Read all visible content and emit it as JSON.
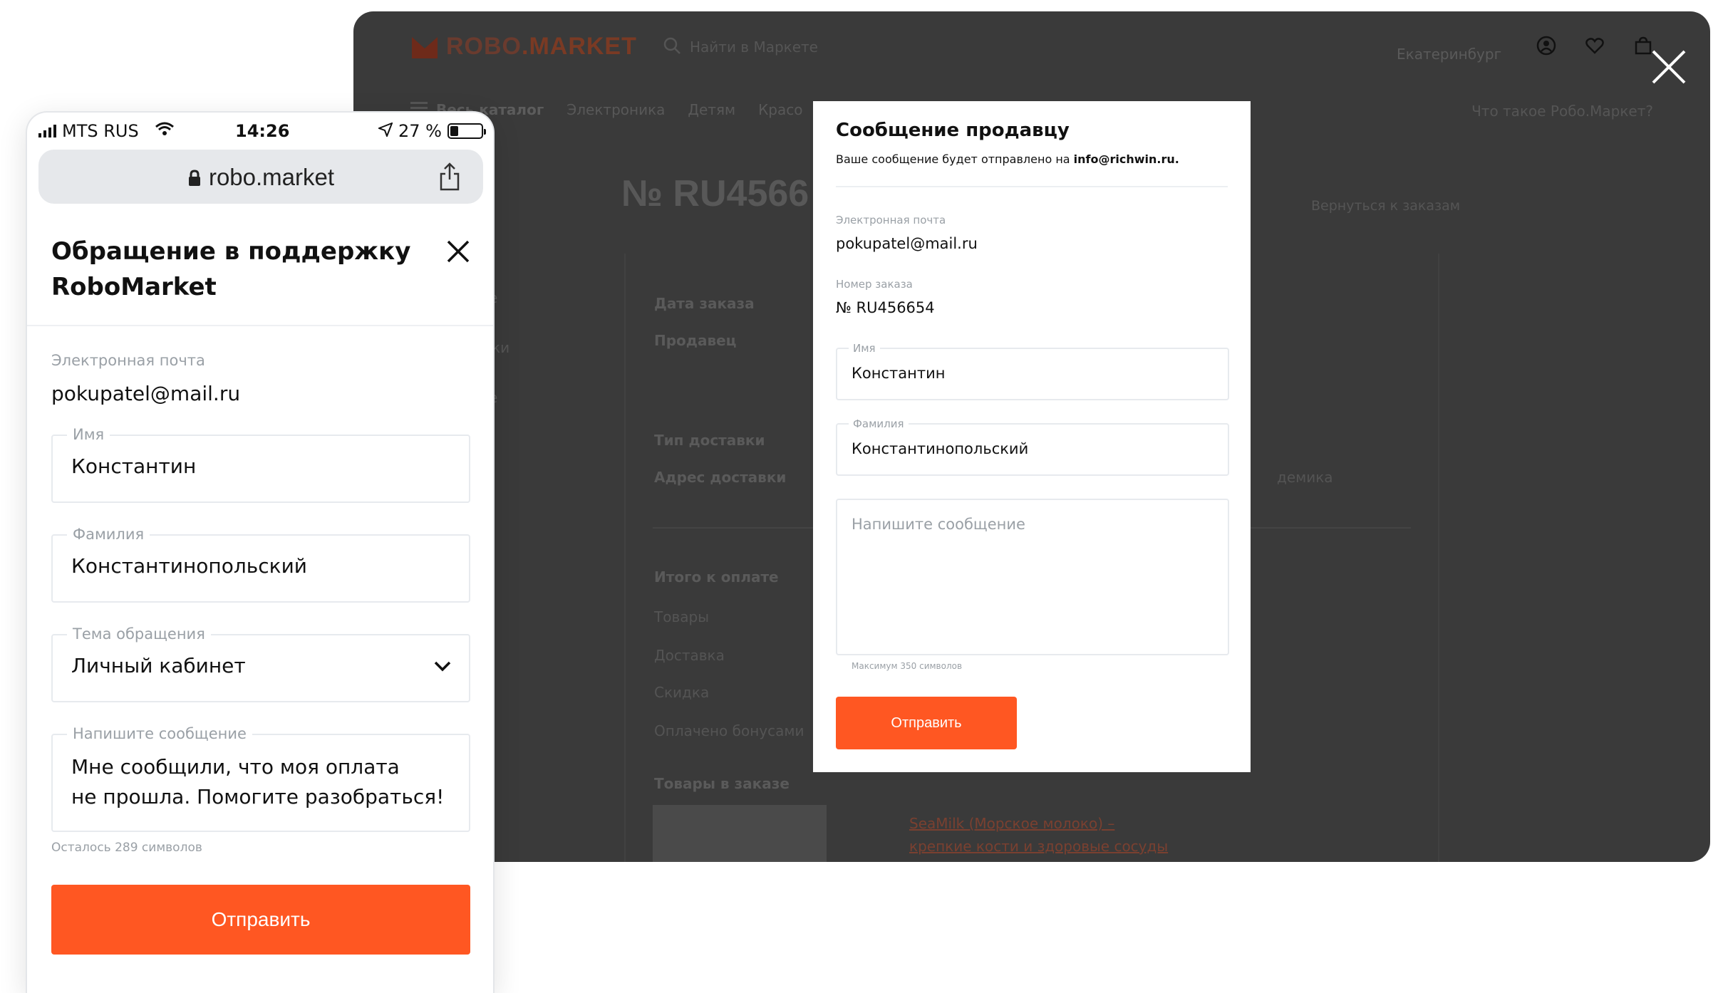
{
  "colors": {
    "accent": "#ff5722",
    "backdrop": "#3a3a3a",
    "muted": "#9aa0a6"
  },
  "desktop": {
    "logo": {
      "part1": "ROBO",
      "part2": ".MARKET"
    },
    "search_placeholder": "Найти в Маркете",
    "city": "Екатеринбург",
    "nav": [
      "Весь каталог",
      "Электроника",
      "Детям",
      "Красо"
    ],
    "whatis": "Что такое Робо.Маркет?",
    "order_title": "№ RU4566",
    "back_link": "Вернуться к заказам",
    "labels": {
      "order_date": "Дата заказа",
      "seller": "Продавец",
      "delivery_type": "Тип доставки",
      "delivery_address": "Адрес доставки",
      "total": "Итого к оплате",
      "goods": "Товары",
      "delivery": "Доставка",
      "discount": "Скидка",
      "bonus": "Оплачено бонусами",
      "items": "Товары в заказе"
    },
    "address_tail": "демика",
    "side_fragments": [
      "е",
      "ки",
      "е"
    ],
    "product_link": [
      "SeaMilk (Морское молоко) –",
      "крепкие кости и здоровые сосуды"
    ]
  },
  "seller_modal": {
    "title": "Сообщение продавцу",
    "note_prefix": "Ваше сообщение будет отправлено на ",
    "note_email": "info@richwin.ru.",
    "email_label": "Электронная почта",
    "email_value": "pokupatel@mail.ru",
    "order_label": "Номер заказа",
    "order_value": "№ RU456654",
    "name_label": "Имя",
    "name_value": "Константин",
    "surname_label": "Фамилия",
    "surname_value": "Константинопольский",
    "message_placeholder": "Напишите сообщение",
    "max_hint": "Максимум 350 символов",
    "submit": "Отправить"
  },
  "phone": {
    "status": {
      "carrier": "MTS RUS",
      "time": "14:26",
      "battery": "27 %",
      "battery_level": 0.27
    },
    "url": "robo.market",
    "title_line1": "Обращение в поддержку",
    "title_line2": "RoboMarket",
    "email_label": "Электронная почта",
    "email_value": "pokupatel@mail.ru",
    "name_label": "Имя",
    "name_value": "Константин",
    "surname_label": "Фамилия",
    "surname_value": "Константинопольский",
    "topic_label": "Тема обращения",
    "topic_value": "Личный кабинет",
    "message_label": "Напишите сообщение",
    "message_line1": "Мне сообщили, что моя оплата",
    "message_line2": "не прошла. Помогите разобраться!",
    "counter": "Осталось 289 символов",
    "submit": "Отправить"
  }
}
